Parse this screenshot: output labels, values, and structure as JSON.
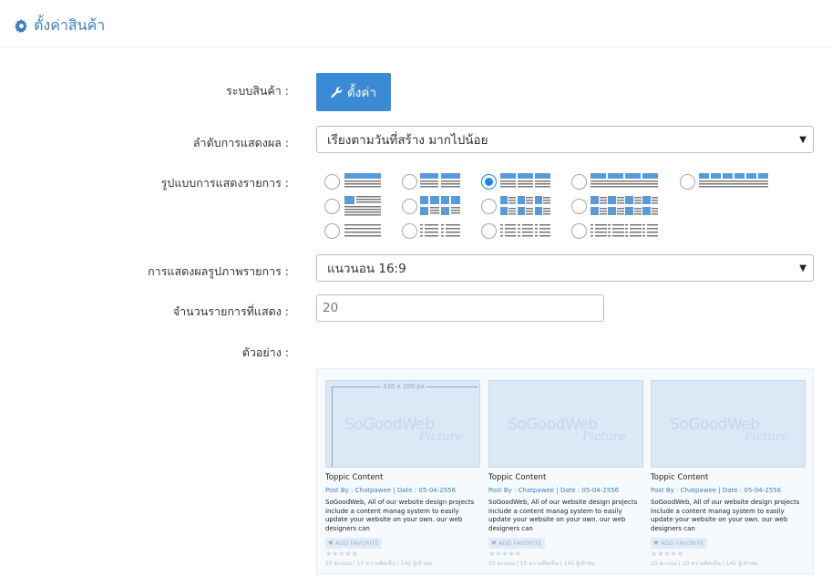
{
  "header": {
    "title": "ตั้งค่าสินค้า",
    "icon": "gear-icon"
  },
  "form": {
    "product_system": {
      "label": "ระบบสินค้า :",
      "button_label": "ตั้งค่า",
      "button_icon": "wrench-icon"
    },
    "sort_order": {
      "label": "ลำดับการแสดงผล :",
      "selected": "เรียงตามวันที่สร้าง มากไปน้อย"
    },
    "list_layout": {
      "label": "รูปแบบการแสดงรายการ :",
      "selected_option": "grid-3-columns"
    },
    "image_display": {
      "label": "การแสดงผลรูปภาพรายการ :",
      "selected": "แนวนอน 16:9"
    },
    "item_count": {
      "label": "จำนวนรายการที่แสดง :",
      "value": "20"
    },
    "preview": {
      "label": "ตัวอย่าง :"
    }
  },
  "preview_cards": [
    {
      "title": "Toppic Content",
      "meta": "Post By : Chatpawee  |  Date : 05-04-2556",
      "desc": "SoGoodWeb, All of our website design projects include a content manag system to easily update your website on your own. our web designers can",
      "fav": "ADD FAVORITE",
      "stats": "20 คะแนน | 10 ความคิดเห็น | 142 ผู้เข้าชม",
      "dim": "330 x 200 px"
    },
    {
      "title": "Toppic Content",
      "meta": "Post By : Chatpawee  |  Date : 05-04-2556",
      "desc": "SoGoodWeb, All of our website design projects include a content manag system to easily update your website on your own. our web designers can",
      "fav": "ADD FAVORITE",
      "stats": "20 คะแนน | 10 ความคิดเห็น | 142 ผู้เข้าชม"
    },
    {
      "title": "Toppic Content",
      "meta": "Post By : Chatpawee  |  Date : 05-04-2556",
      "desc": "SoGoodWeb, All of our website design projects include a content manag system to easily update your website on your own. our web designers can",
      "fav": "ADD FAVORITE",
      "stats": "20 คะแนน | 10 ความคิดเห็น | 142 ผู้เข้าชม"
    }
  ],
  "watermark": {
    "line1": "SoGoodWeb",
    "line2": "Picture"
  },
  "colors": {
    "accent": "#3a8ad6",
    "title": "#3a7fc1",
    "checked": "#1e88e5",
    "icon_blue": "#5a9ad8"
  }
}
